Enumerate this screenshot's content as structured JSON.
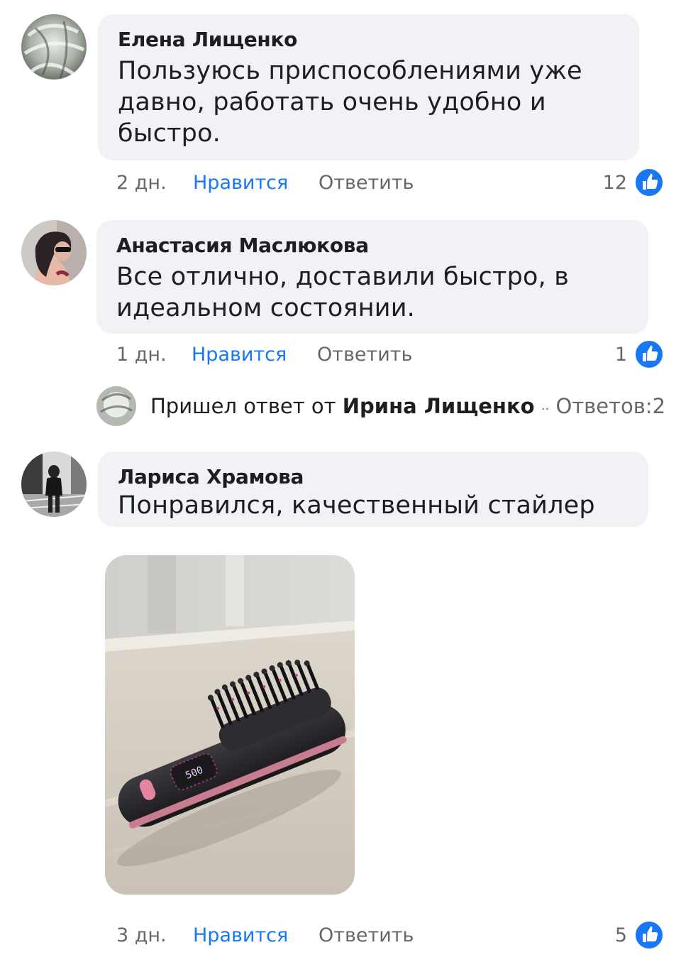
{
  "comments": [
    {
      "author": "Елена Лищенко",
      "text": "Пользуюсь приспособлениями уже давно, работать очень удобно и быстро.",
      "time": "2 дн.",
      "like_label": "Нравится",
      "reply_label": "Ответить",
      "like_count": "12"
    },
    {
      "author": "Анастасия Маслюкова",
      "text": "Все отлично, доставили быстро, в идеальном состоянии.",
      "time": "1 дн.",
      "like_label": "Нравится",
      "reply_label": "Ответить",
      "like_count": "1"
    },
    {
      "author": "Лариса Храмова",
      "text": "Понравился, качественный стайлер",
      "time": "3 дн.",
      "like_label": "Нравится",
      "reply_label": "Ответить",
      "like_count": "5"
    }
  ],
  "reply_thread": {
    "prefix": "Пришел ответ от",
    "author": "Ирина Лищенко",
    "separator": "··",
    "replies_count": "Ответов:2"
  },
  "photo": {
    "display_text": "500",
    "icon": "hair-straightener-brush-photo"
  },
  "colors": {
    "accent": "#1877f2",
    "bubble": "#f0f2f5",
    "meta": "#65676b"
  }
}
